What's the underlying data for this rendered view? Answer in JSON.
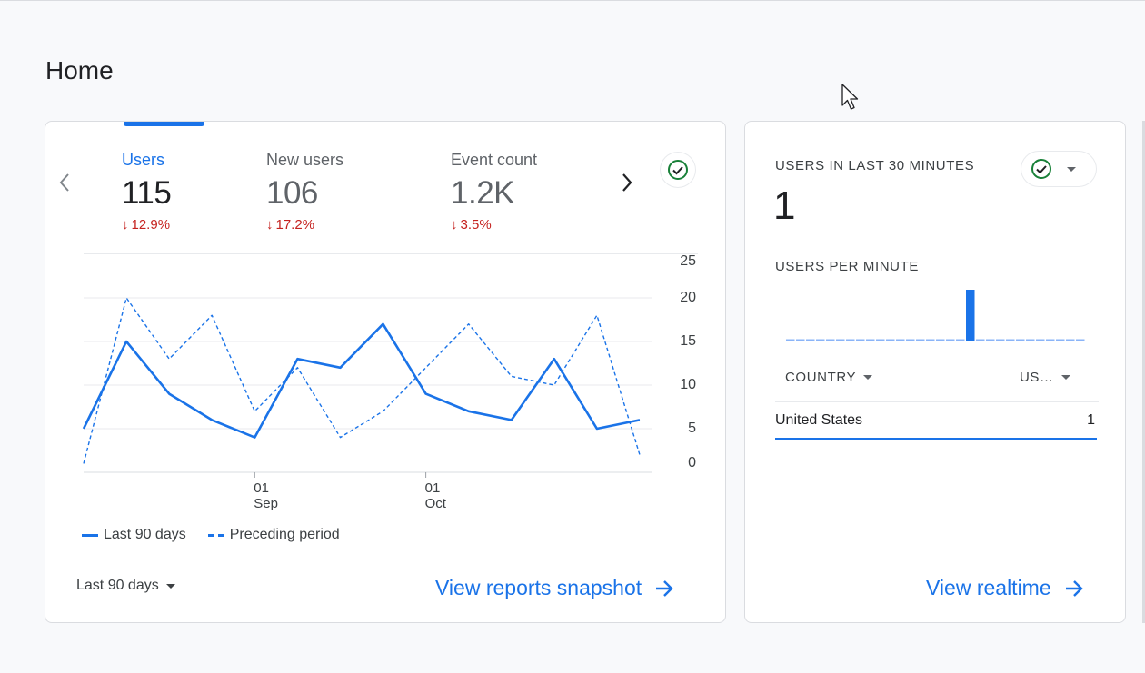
{
  "page": {
    "title": "Home"
  },
  "colors": {
    "accent": "#1a73e8",
    "negative": "#c5221f",
    "success": "#188038"
  },
  "main_card": {
    "metrics": [
      {
        "label": "Users",
        "value": "115",
        "change": "12.9%",
        "direction": "down",
        "active": true
      },
      {
        "label": "New users",
        "value": "106",
        "change": "17.2%",
        "direction": "down",
        "active": false
      },
      {
        "label": "Event count",
        "value": "1.2K",
        "change": "3.5%",
        "direction": "down",
        "active": false
      }
    ],
    "legend": {
      "current": "Last 90 days",
      "previous": "Preceding period"
    },
    "date_range": "Last 90 days",
    "link": "View reports snapshot"
  },
  "chart_data": {
    "type": "line",
    "y_ticks": [
      "25",
      "20",
      "15",
      "10",
      "5",
      "0"
    ],
    "ylim": [
      0,
      25
    ],
    "x_ticks": [
      {
        "day": "01",
        "month": "Sep",
        "index": 4
      },
      {
        "day": "01",
        "month": "Oct",
        "index": 8
      }
    ],
    "x_count": 14,
    "grid": true,
    "legend_position": "bottom-left",
    "series": [
      {
        "name": "Last 90 days",
        "style": "solid",
        "values": [
          5,
          15,
          9,
          6,
          4,
          13,
          12,
          17,
          9,
          7,
          6,
          13,
          5,
          6
        ]
      },
      {
        "name": "Preceding period",
        "style": "dashed",
        "values": [
          1,
          20,
          13,
          18,
          7,
          12,
          4,
          7,
          12,
          17,
          11,
          10,
          18,
          2
        ]
      }
    ]
  },
  "realtime_card": {
    "title": "USERS IN LAST 30 MINUTES",
    "value": "1",
    "subtitle": "USERS PER MINUTE",
    "per_minute": [
      0,
      0,
      0,
      0,
      0,
      0,
      0,
      0,
      0,
      0,
      0,
      0,
      0,
      0,
      0,
      0,
      0,
      0,
      1,
      0,
      0,
      0,
      0,
      0,
      0,
      0,
      0,
      0,
      0,
      0
    ],
    "columns": {
      "country": "COUNTRY",
      "users": "US…"
    },
    "rows": [
      {
        "country": "United States",
        "users": "1",
        "share": 1
      }
    ],
    "link": "View realtime"
  },
  "icons": {
    "check": "check-circle-icon",
    "arrow_right": "arrow-right-icon",
    "chevron_left": "chevron-left-icon",
    "chevron_right": "chevron-right-icon",
    "dropdown": "caret-down-icon"
  }
}
